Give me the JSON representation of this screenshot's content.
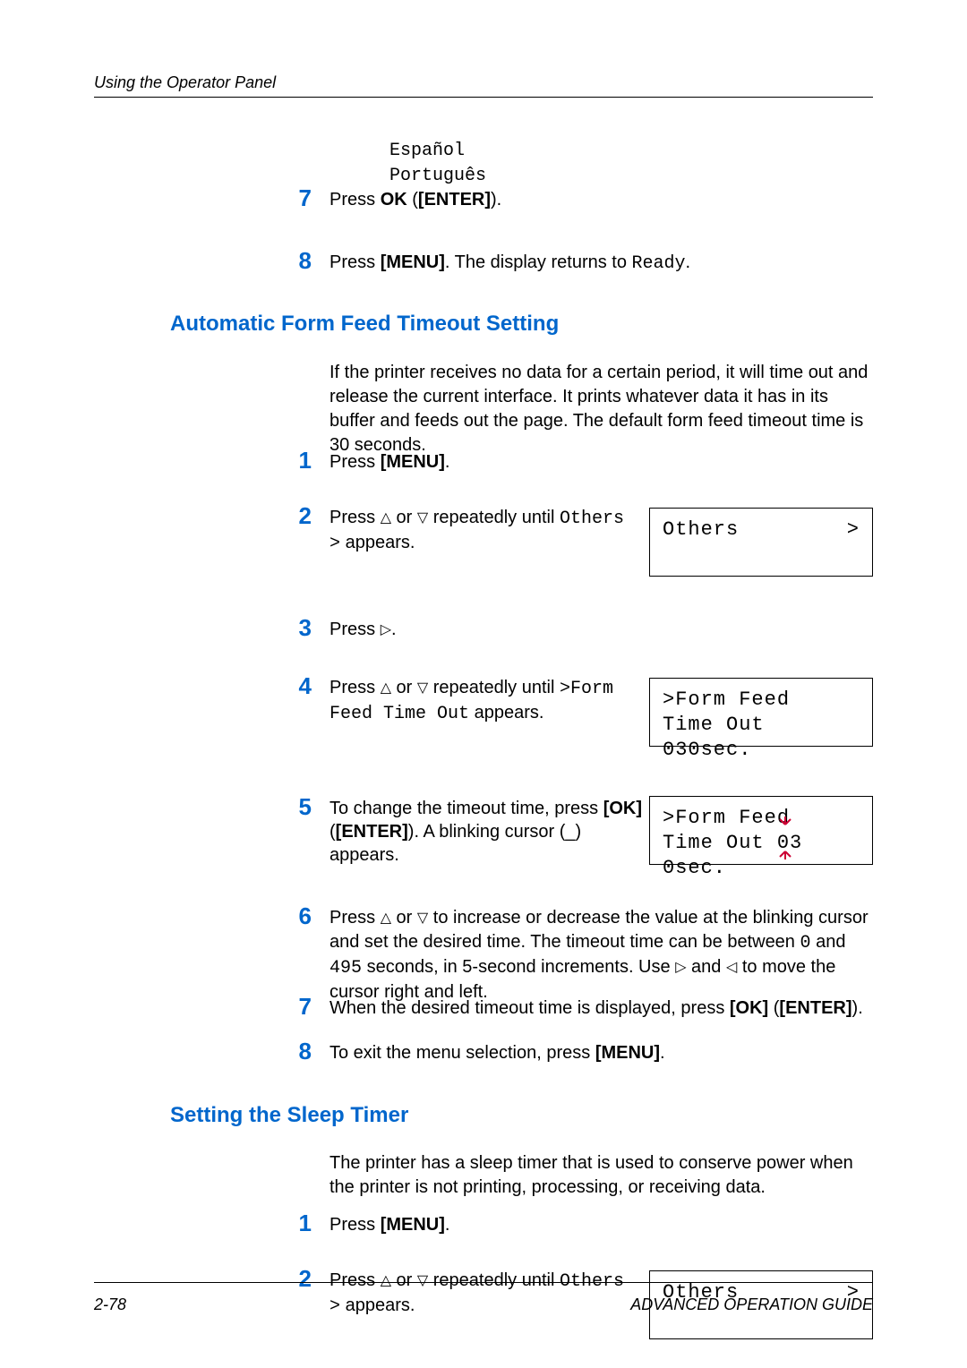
{
  "header": "Using the Operator Panel",
  "footer_page": "2-78",
  "footer_guide": "ADVANCED OPERATION GUIDE",
  "langs": {
    "es": "Español",
    "pt": "Português"
  },
  "top_steps": {
    "n7": "7",
    "t7_a": "Press ",
    "t7_b": "OK",
    "t7_c": " (",
    "t7_d": "[ENTER]",
    "t7_e": ").",
    "n8": "8",
    "t8_a": "Press ",
    "t8_b": "[MENU]",
    "t8_c": ". The display returns to ",
    "t8_d": "Ready",
    "t8_e": "."
  },
  "section1": {
    "title": "Automatic Form Feed Timeout Setting",
    "intro": "If the printer receives no data for a certain period, it will time out and release the current interface. It prints whatever data it has in its buffer and feeds out the page. The default form feed timeout time is 30 seconds.",
    "n1": "1",
    "s1_a": "Press ",
    "s1_b": "[MENU]",
    "s1_c": ".",
    "n2": "2",
    "s2_a": "Press ",
    "s2_b": " or ",
    "s2_c": " repeatedly until ",
    "s2_d": "Others >",
    "s2_e": " appears.",
    "n3": "3",
    "s3_a": "Press ",
    "s3_b": ".",
    "n4": "4",
    "s4_a": "Press ",
    "s4_b": " or ",
    "s4_c": " repeatedly until ",
    "s4_d": ">Form Feed Time Out",
    "s4_e": " appears.",
    "n5": "5",
    "s5_a": "To change the timeout time, press ",
    "s5_b": "[OK]",
    "s5_c": " (",
    "s5_d": "[ENTER]",
    "s5_e": "). A blinking cursor (_) appears.",
    "n6": "6",
    "s6_a": "Press ",
    "s6_b": " or ",
    "s6_c": " to increase or decrease the value at the blinking cursor and set the desired time. The timeout time can be between ",
    "s6_d": "0",
    "s6_e": " and ",
    "s6_f": "495",
    "s6_g": " seconds, in 5-second increments. Use ",
    "s6_h": " and ",
    "s6_i": " to move the cursor right and left.",
    "n7": "7",
    "s7_a": "When the desired timeout time is displayed, press ",
    "s7_b": "[OK]",
    "s7_c": " (",
    "s7_d": "[ENTER]",
    "s7_e": ").",
    "n8": "8",
    "s8_a": " To exit the menu selection, press ",
    "s8_b": "[MENU]",
    "s8_c": "."
  },
  "lcd": {
    "others_l1": "Others",
    "gt": ">",
    "ff_l1": ">Form Feed",
    "ff_l2a": "Time Out 030sec.",
    "ff2_l1": ">Form Feed",
    "ff2_l2_pre": "Time Out 0",
    "ff2_l2_cur": "3",
    "ff2_l2_post": "0sec."
  },
  "section2": {
    "title": "Setting the Sleep Timer",
    "intro": "The printer has a sleep timer that is used to conserve power when the printer is not printing, processing, or receiving data.",
    "n1": "1",
    "s1_a": "Press ",
    "s1_b": "[MENU]",
    "s1_c": ".",
    "n2": "2",
    "s2_a": "Press ",
    "s2_b": " or ",
    "s2_c": " repeatedly until ",
    "s2_d": "Others >",
    "s2_e": " appears."
  }
}
